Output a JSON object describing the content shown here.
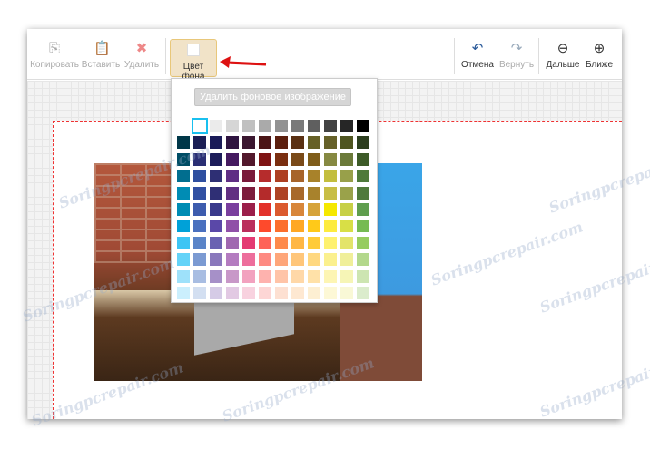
{
  "toolbar": {
    "copy": "Копировать",
    "paste": "Вставить",
    "delete": "Удалить",
    "bg_color": "Цвет фона",
    "undo": "Отмена",
    "redo": "Вернуть",
    "zoom_out": "Дальше",
    "zoom_in": "Ближе"
  },
  "popup": {
    "remove_bg_image": "Удалить фоновое изображение",
    "selected_color": "#ffffff",
    "palette": [
      [
        "transparent",
        "#ffffff",
        "#ebebeb",
        "#d6d6d6",
        "#c0c0c0",
        "#aaaaaa",
        "#929292",
        "#7a7a7a",
        "#5f5f5f",
        "#434343",
        "#262626",
        "#000000"
      ],
      [
        "#003748",
        "#1b1f55",
        "#1a1b58",
        "#2f1440",
        "#3b1730",
        "#4b1516",
        "#5c1f0e",
        "#5a3012",
        "#666026",
        "#666129",
        "#4f5520",
        "#2c3e1e"
      ],
      [
        "#004d65",
        "#2a2f74",
        "#1d1d5a",
        "#451a60",
        "#52182c",
        "#7f1414",
        "#7a2e10",
        "#7a4a18",
        "#7f5d1a",
        "#868942",
        "#6b7a3a",
        "#3d5b28"
      ],
      [
        "#016e8f",
        "#2f4fa0",
        "#2e2f74",
        "#5f2e84",
        "#7a1a3a",
        "#b62c2c",
        "#ad3f22",
        "#a7642a",
        "#a8822a",
        "#c3be3e",
        "#98a04a",
        "#4e7a3a"
      ],
      [
        "#008cb4",
        "#3150a3",
        "#2f2f75",
        "#622f82",
        "#7d1c3c",
        "#b42b2b",
        "#ae4325",
        "#a8692b",
        "#a8822c",
        "#c8be45",
        "#9aa24a",
        "#4f7a3b"
      ],
      [
        "#008cb4",
        "#3d5cae",
        "#3a3a8c",
        "#7a3f9e",
        "#9b1f4a",
        "#e3322b",
        "#db5a2e",
        "#d8863a",
        "#d6a33a",
        "#f5e800",
        "#c7d046",
        "#5f9e4e"
      ],
      [
        "#00a1d8",
        "#4a70bf",
        "#5a48a8",
        "#9050a8",
        "#bb2f5c",
        "#fe4a2c",
        "#fc6e2c",
        "#ffa824",
        "#ffc919",
        "#fdeb3e",
        "#d8df46",
        "#76bb52"
      ],
      [
        "#3ec5f4",
        "#5a84c8",
        "#6a62b2",
        "#a068b0",
        "#e43b73",
        "#fe6358",
        "#fe8a4c",
        "#ffb745",
        "#ffcb38",
        "#fef16f",
        "#e3e46a",
        "#96cc5f"
      ],
      [
        "#64d3f8",
        "#7b9ad2",
        "#8a78bc",
        "#b47cc0",
        "#ed6e9c",
        "#fe8a82",
        "#fea67a",
        "#ffc67a",
        "#ffd880",
        "#fbf08e",
        "#f0ef9a",
        "#b3d88c"
      ],
      [
        "#9ee1fa",
        "#a8bde2",
        "#a690c8",
        "#c898c8",
        "#f2a2bf",
        "#feb2ae",
        "#ffc4a8",
        "#ffd8a8",
        "#ffe1a8",
        "#fdf5b4",
        "#f6f5b6",
        "#cde5b2"
      ],
      [
        "#cbeffd",
        "#d3dff1",
        "#d5cbe6",
        "#e2c9e3",
        "#f8d2df",
        "#fdd6d5",
        "#fde0d2",
        "#fee8d1",
        "#fdefd2",
        "#fdf8d6",
        "#f9f8d6",
        "#dbeccc"
      ]
    ]
  },
  "watermark": "Soringpcrepair.com"
}
